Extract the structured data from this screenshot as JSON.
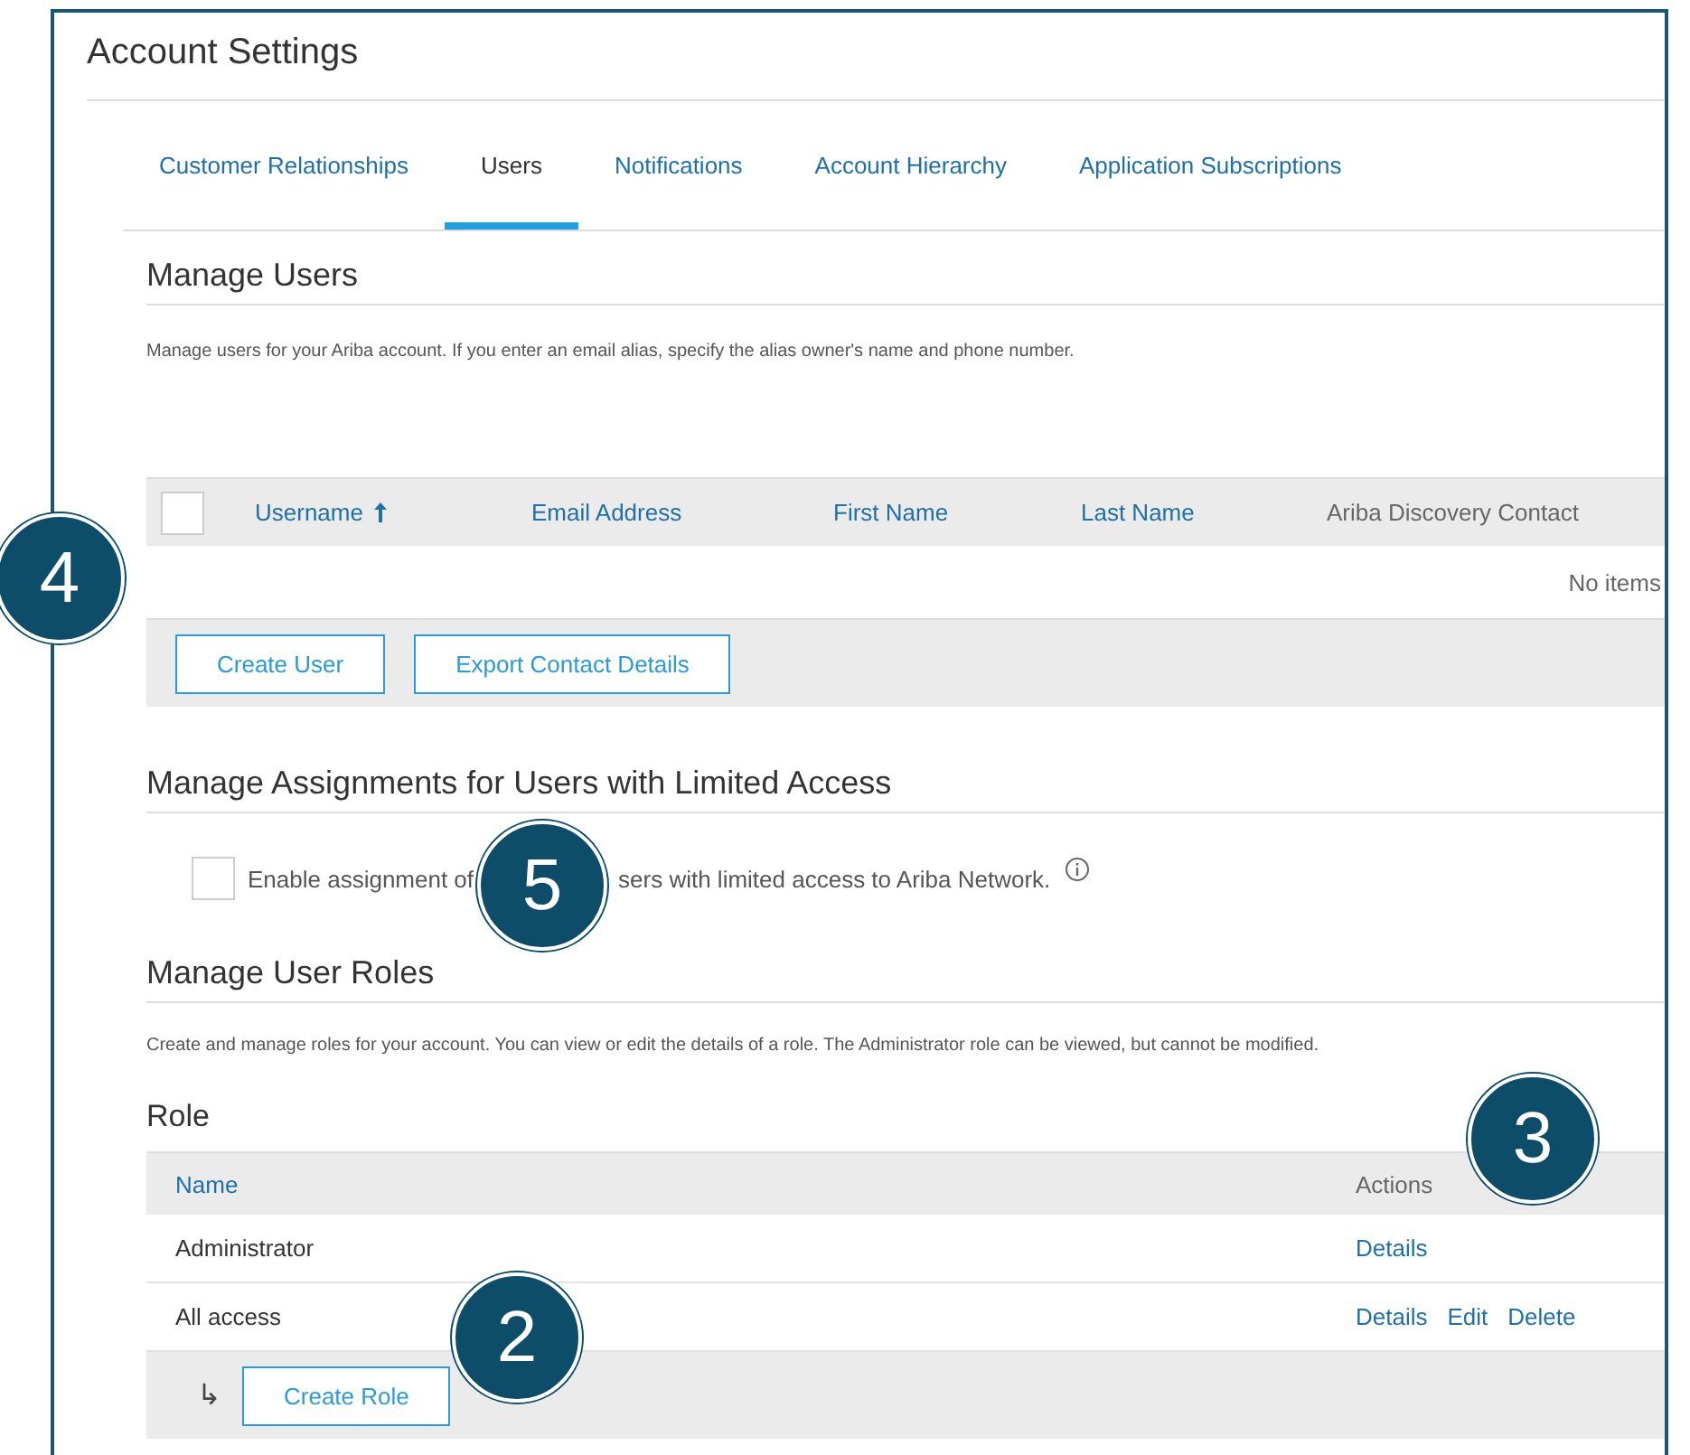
{
  "page": {
    "title": "Account Settings"
  },
  "tabs": [
    {
      "label": "Customer Relationships",
      "selected": false
    },
    {
      "label": "Users",
      "selected": true
    },
    {
      "label": "Notifications",
      "selected": false
    },
    {
      "label": "Account Hierarchy",
      "selected": false
    },
    {
      "label": "Application Subscriptions",
      "selected": false
    }
  ],
  "manage_users": {
    "heading": "Manage Users",
    "description": "Manage users for your Ariba account. If you enter an email alias, specify the alias owner's name and phone number.",
    "table": {
      "select_all": {
        "checked": false
      },
      "columns": [
        {
          "label": "Username",
          "sortable": true,
          "sorted": true
        },
        {
          "label": "Email Address",
          "sortable": true,
          "sorted": false
        },
        {
          "label": "First Name",
          "sortable": true,
          "sorted": false
        },
        {
          "label": "Last Name",
          "sortable": true,
          "sorted": false
        },
        {
          "label": "Ariba Discovery Contact",
          "sortable": false,
          "sorted": false
        }
      ],
      "empty_text": "No items"
    },
    "buttons": [
      "Create User",
      "Export Contact Details"
    ],
    "callout": "4"
  },
  "limited_access": {
    "heading": "Manage Assignments for Users with Limited Access",
    "checkbox": {
      "checked": false,
      "label_before": "Enable assignment of",
      "label_after": "sers with limited access to Ariba Network."
    },
    "callout": "5"
  },
  "user_roles": {
    "heading": "Manage User Roles",
    "description": "Create and manage roles for your account. You can view or edit the details of a role. The Administrator role can be viewed, but cannot be modified.",
    "subheading": "Role",
    "callout": "3",
    "table": {
      "columns": [
        {
          "label": "Name",
          "sortable": true
        },
        {
          "label": "Actions",
          "sortable": false
        }
      ],
      "rows": [
        {
          "name": "Administrator",
          "actions": [
            "Details"
          ]
        },
        {
          "name": "All access",
          "actions": [
            "Details",
            "Edit",
            "Delete"
          ]
        }
      ]
    },
    "footer": {
      "arrow": "↳",
      "button": "Create Role",
      "callout": "2"
    }
  }
}
